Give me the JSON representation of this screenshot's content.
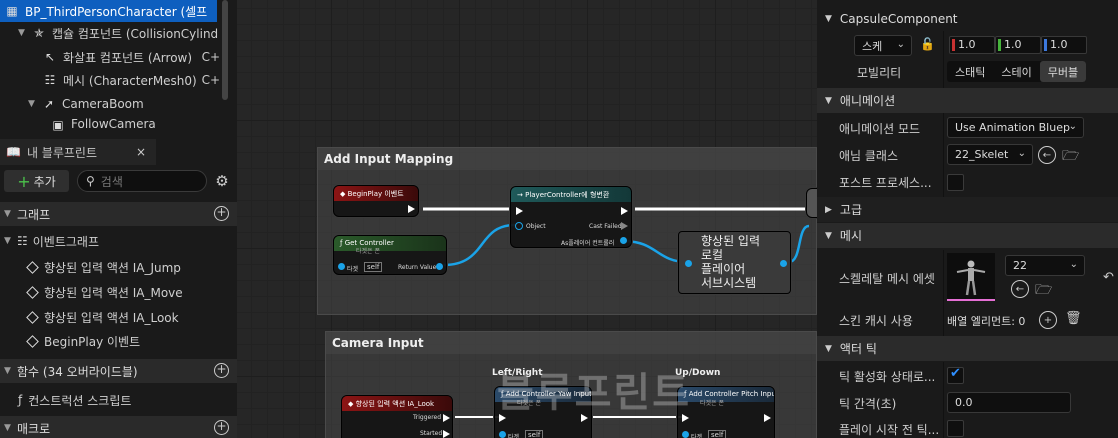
{
  "components": {
    "root": "BP_ThirdPersonCharacter (셀프",
    "items": [
      {
        "label": "캡슐 컴포넌트 (CollisionCylind",
        "icon": "capsule-icon"
      },
      {
        "label": "화살표 컴포넌트 (Arrow)",
        "suffix": "C+",
        "icon": "arrow-icon"
      },
      {
        "label": "메시 (CharacterMesh0)",
        "suffix": "C+",
        "icon": "skeleton-icon"
      },
      {
        "label": "CameraBoom",
        "icon": "camera-boom-icon"
      },
      {
        "label": "FollowCamera",
        "icon": "camera-icon"
      }
    ]
  },
  "my_blueprint": {
    "tab_label": "내 블루프린트",
    "close": "×",
    "add_label": "추가",
    "search_placeholder": "검색",
    "sections": {
      "graph": "그래프",
      "functions": "함수 (34 오버라이드블)",
      "macros": "매크로"
    },
    "event_graph": "이벤트그래프",
    "events": [
      "향상된 입력 액션 IA_Jump",
      "향상된 입력 액션 IA_Move",
      "향상된 입력 액션 IA_Look",
      "BeginPlay 이벤트"
    ],
    "construction_script": "컨스트럭션 스크립트"
  },
  "graph": {
    "comment1": "Add Input Mapping",
    "comment2": "Camera Input",
    "nodes": {
      "begin_play": "BeginPlay 이벤트",
      "get_controller": "Get Controller",
      "get_controller_sub": "타겟은 폰",
      "target": "타겟",
      "self": "self",
      "return_value": "Return Value",
      "cast": "PlayerController에 형변환",
      "object": "Object",
      "cast_failed": "Cast Failed",
      "as_player_controller": "As플레이어 컨트롤러",
      "enhanced_subsystem": "향상된 입력\n로컬\n플레이어\n서브시스템",
      "ia_look": "향상된 입력 액션 IA_Look",
      "triggered": "Triggered",
      "started": "Started",
      "yaw": "Add Controller Yaw Input",
      "yaw_sub": "타겟은 폰",
      "pitch": "Add Controller Pitch Input",
      "pitch_sub": "타겟은 폰"
    },
    "left_right": "Left/Right",
    "up_down": "Up/Down",
    "watermark": "블루프린트"
  },
  "details": {
    "capsule_component": "CapsuleComponent",
    "scale_label": "스케",
    "scale": [
      "1.0",
      "1.0",
      "1.0"
    ],
    "mobility_label": "모빌리티",
    "mobility_options": [
      "스태틱",
      "스테이",
      "무버블"
    ],
    "animation_section": "애니메이션",
    "anim_mode_label": "애니메이션 모드",
    "anim_mode_value": "Use Animation Bluep",
    "anim_class_label": "애님 클래스",
    "anim_class_value": "22_Skelet",
    "post_process_label": "포스트 프로세스...",
    "advanced_section": "고급",
    "mesh_section": "메시",
    "skeletal_mesh_label": "스켈레탈 메시 에셋",
    "skeletal_mesh_value": "22",
    "skin_cache_label": "스킨 캐시 사용",
    "array_elements": "배열 엘리먼트: 0",
    "actor_tick_section": "액터 틱",
    "tick_enabled_label": "틱 활성화 상태로...",
    "tick_interval_label": "틱 간격(초)",
    "tick_interval_value": "0.0",
    "tick_before_play_label": "플레이 시작 전 틱..."
  },
  "colors": {
    "accent": "#0e5fbf",
    "exec_red": "#8c1414",
    "pure_green": "#2a5a2a",
    "cast_teal": "#1f5a5a",
    "wire_blue": "#1aa3e8",
    "scale_r": "#c83232",
    "scale_g": "#46b43c",
    "scale_b": "#3c78dc"
  }
}
